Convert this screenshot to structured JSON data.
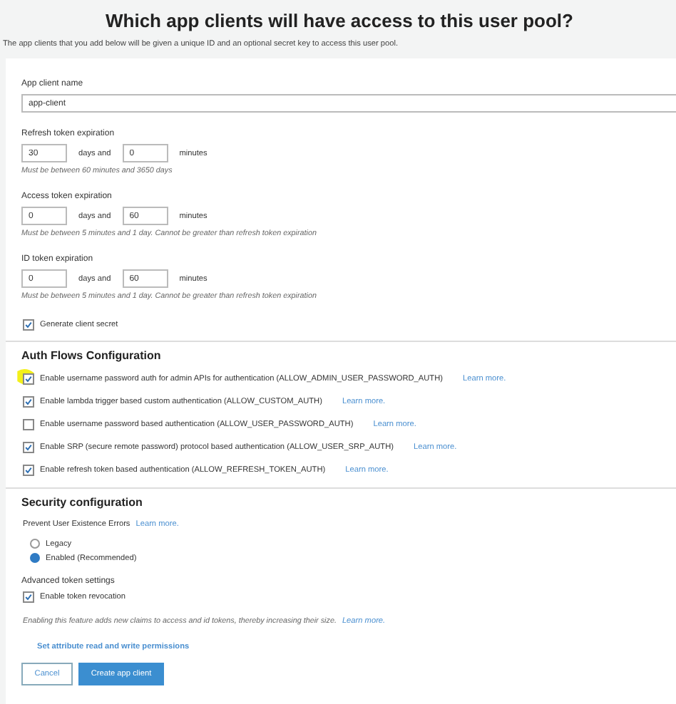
{
  "header": {
    "title": "Which app clients will have access to this user pool?",
    "subtitle": "The app clients that you add below will be given a unique ID and an optional secret key to access this user pool."
  },
  "app_client_name": {
    "label": "App client name",
    "value": "app-client"
  },
  "expirations": [
    {
      "label": "Refresh token expiration",
      "days": "30",
      "days_label": "days and",
      "minutes": "0",
      "minutes_label": "minutes",
      "hint": "Must be between 60 minutes and 3650 days"
    },
    {
      "label": "Access token expiration",
      "days": "0",
      "days_label": "days and",
      "minutes": "60",
      "minutes_label": "minutes",
      "hint": "Must be between 5 minutes and 1 day. Cannot be greater than refresh token expiration"
    },
    {
      "label": "ID token expiration",
      "days": "0",
      "days_label": "days and",
      "minutes": "60",
      "minutes_label": "minutes",
      "hint": "Must be between 5 minutes and 1 day. Cannot be greater than refresh token expiration"
    }
  ],
  "generate_secret": {
    "label": "Generate client secret",
    "checked": true
  },
  "auth_flows": {
    "title": "Auth Flows Configuration",
    "items": [
      {
        "label": "Enable username password auth for admin APIs for authentication (ALLOW_ADMIN_USER_PASSWORD_AUTH)",
        "checked": true,
        "highlighted": true,
        "link": "Learn more."
      },
      {
        "label": "Enable lambda trigger based custom authentication (ALLOW_CUSTOM_AUTH)",
        "checked": true,
        "highlighted": false,
        "link": "Learn more."
      },
      {
        "label": "Enable username password based authentication (ALLOW_USER_PASSWORD_AUTH)",
        "checked": false,
        "highlighted": false,
        "link": "Learn more."
      },
      {
        "label": "Enable SRP (secure remote password) protocol based authentication (ALLOW_USER_SRP_AUTH)",
        "checked": true,
        "highlighted": false,
        "link": "Learn more."
      },
      {
        "label": "Enable refresh token based authentication (ALLOW_REFRESH_TOKEN_AUTH)",
        "checked": true,
        "highlighted": false,
        "link": "Learn more."
      }
    ]
  },
  "security": {
    "title": "Security configuration",
    "prevent_label": "Prevent User Existence Errors",
    "prevent_link": "Learn more.",
    "options": [
      {
        "label": "Legacy",
        "selected": false
      },
      {
        "label": "Enabled (Recommended)",
        "selected": true
      }
    ],
    "advanced_title": "Advanced token settings",
    "revocation": {
      "label": "Enable token revocation",
      "checked": true
    },
    "revocation_hint": "Enabling this feature adds new claims to access and id tokens, thereby increasing their size.",
    "revocation_link": "Learn more."
  },
  "attribute_link": "Set attribute read and write permissions",
  "buttons": {
    "cancel": "Cancel",
    "create": "Create app client"
  }
}
